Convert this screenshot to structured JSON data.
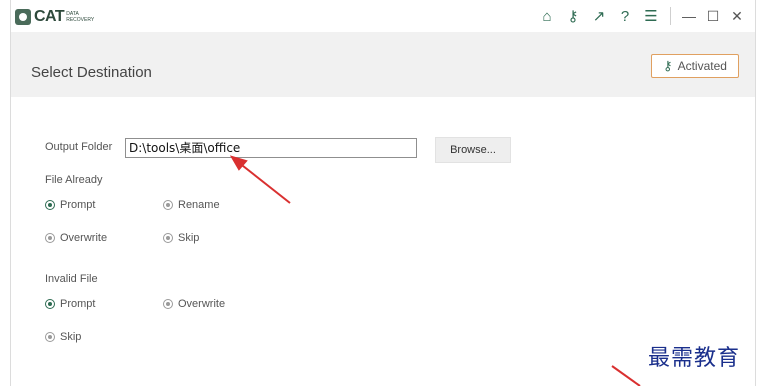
{
  "app": {
    "logo_word": "CAT",
    "logo_sub": "DATA RECOVERY"
  },
  "titlebar": {
    "icons": [
      "home-icon",
      "key-icon",
      "arrow-upright-icon",
      "help-icon",
      "menu-icon"
    ],
    "window_controls": [
      "minimize-icon",
      "maximize-icon",
      "close-icon"
    ]
  },
  "header": {
    "title": "Select Destination",
    "activated_label": "Activated"
  },
  "form": {
    "output_folder_label": "Output Folder",
    "output_folder_value": "D:\\tools\\桌面\\office",
    "browse_label": "Browse...",
    "file_already": {
      "label": "File Already",
      "options": [
        {
          "label": "Prompt",
          "selected": true
        },
        {
          "label": "Rename",
          "selected": false
        },
        {
          "label": "Overwrite",
          "selected": false
        },
        {
          "label": "Skip",
          "selected": false
        }
      ]
    },
    "invalid_file": {
      "label": "Invalid File",
      "options": [
        {
          "label": "Prompt",
          "selected": true
        },
        {
          "label": "Overwrite",
          "selected": false
        },
        {
          "label": "Skip",
          "selected": false
        }
      ]
    }
  },
  "watermark": "最需教育",
  "colors": {
    "accent": "#2e6b52",
    "activated_border": "#e0a060",
    "annotation_arrow": "#d93030",
    "watermark": "#1a2f8c"
  }
}
